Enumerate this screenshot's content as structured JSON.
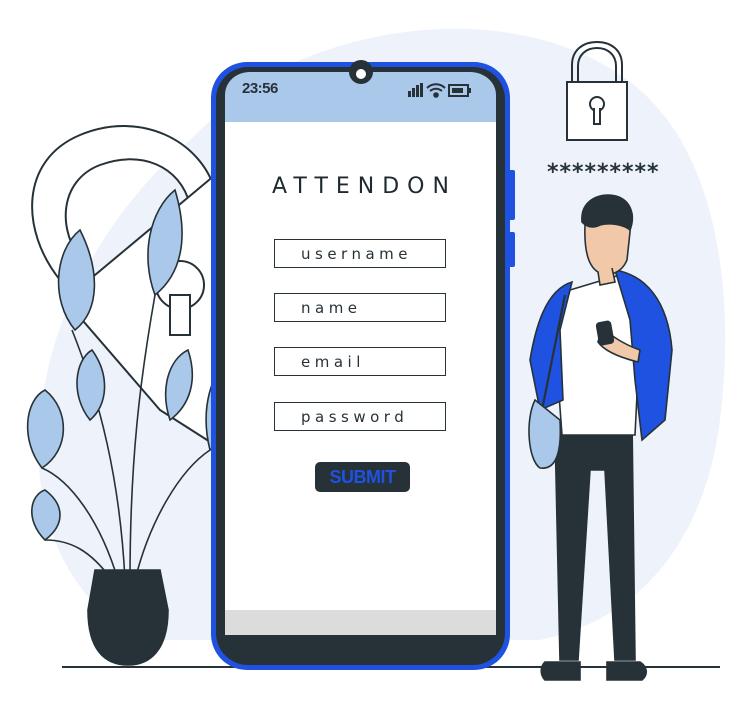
{
  "status_bar": {
    "time": "23:56",
    "icons": [
      "signal-icon",
      "wifi-icon",
      "battery-icon"
    ]
  },
  "app": {
    "title": "ATTENDON"
  },
  "form": {
    "username_placeholder": "username",
    "name_placeholder": "name",
    "email_placeholder": "email",
    "password_placeholder": "password",
    "submit_label": "SUBMIT"
  },
  "decoration": {
    "password_mask": "*********",
    "icons": [
      "padlock-icon",
      "large-padlock-icon",
      "plant-icon",
      "person-with-phone-icon"
    ]
  },
  "colors": {
    "accent_blue": "#1f52e0",
    "light_blue": "#a9c8ea",
    "background_blob": "#eef3fb",
    "dark": "#263238",
    "status_bar": "#a9c8ea"
  }
}
